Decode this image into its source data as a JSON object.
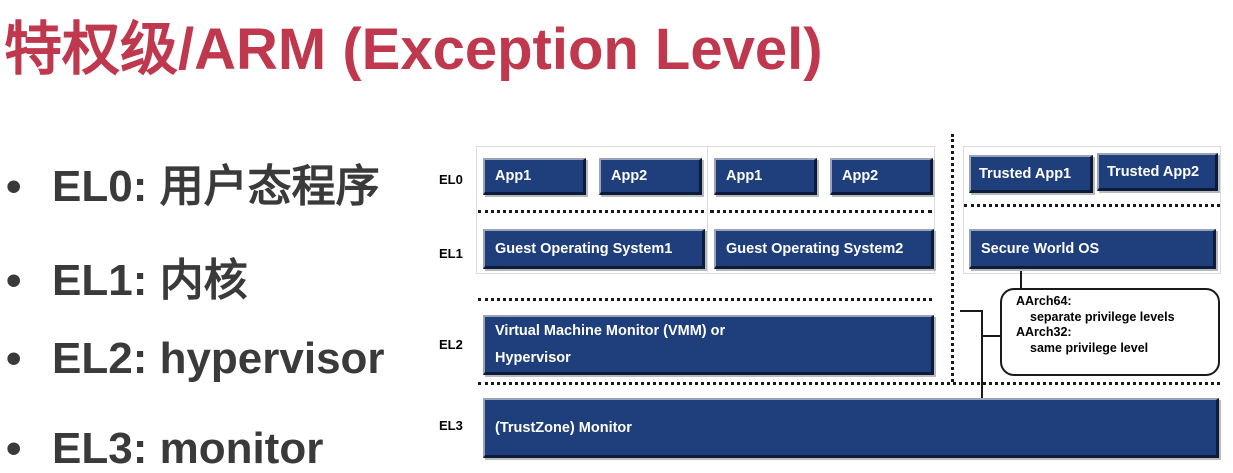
{
  "title": "特权级/ARM (Exception Level)",
  "bullets": [
    {
      "marker": "•",
      "text": "EL0: 用户态程序"
    },
    {
      "marker": "•",
      "text": "EL1: 内核"
    },
    {
      "marker": "•",
      "text": "EL2: hypervisor"
    },
    {
      "marker": "•",
      "text": "EL3: monitor"
    }
  ],
  "diagram": {
    "levels": [
      "EL0",
      "EL1",
      "EL2",
      "EL3"
    ],
    "el0_apps": [
      "App1",
      "App2",
      "App1",
      "App2"
    ],
    "trusted_apps": [
      "Trusted App1",
      "Trusted App2"
    ],
    "guest_os": [
      "Guest Operating System1",
      "Guest Operating System2"
    ],
    "secure_os": "Secure World OS",
    "vmm_line1": "Virtual Machine Monitor (VMM) or",
    "vmm_line2": "Hypervisor",
    "monitor": "(TrustZone) Monitor",
    "callout": {
      "line1": "AArch64:",
      "line2": "separate privilege levels",
      "line3": "AArch32:",
      "line4": "same privilege level"
    },
    "colors": {
      "box_fill": "#1F3E7C",
      "title": "#C0384E",
      "bullet_text": "#3a3a3a"
    }
  }
}
